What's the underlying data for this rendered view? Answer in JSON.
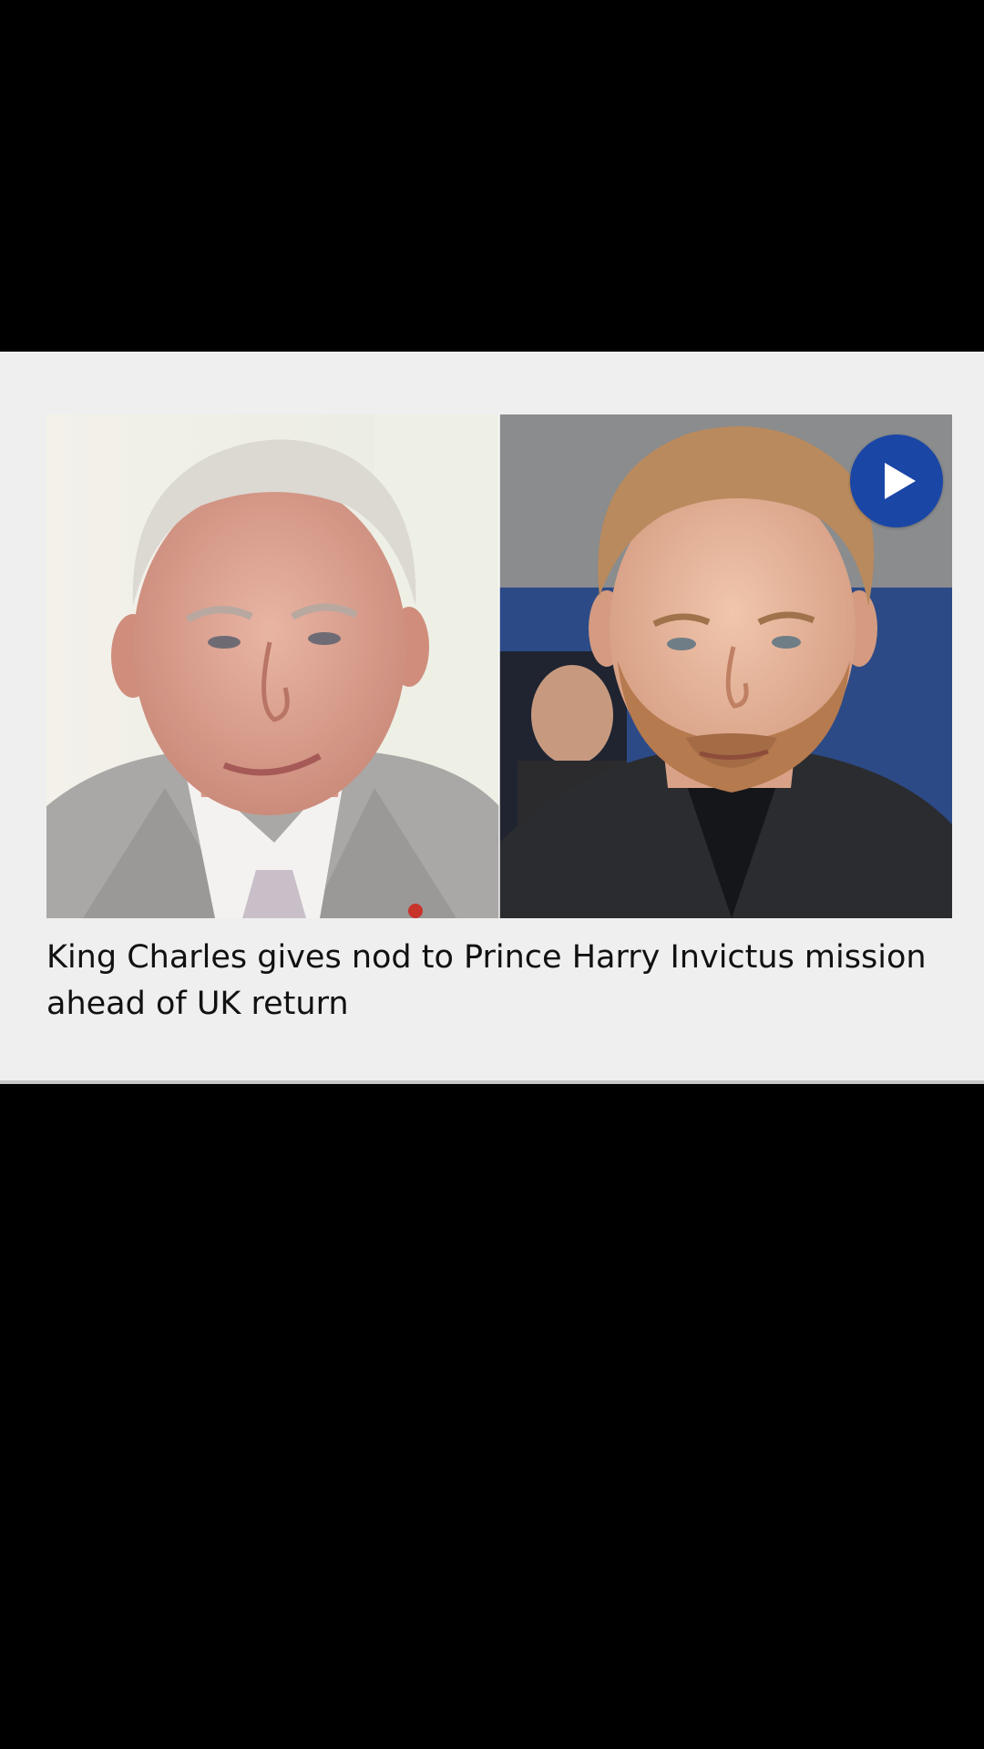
{
  "article": {
    "headline": "King Charles gives nod to Prince Harry Invictus mission ahead of UK return",
    "images": [
      {
        "subject": "King Charles",
        "icon": "portrait-photo"
      },
      {
        "subject": "Prince Harry",
        "icon": "portrait-photo"
      }
    ],
    "play_icon": "play-icon",
    "accent_color": "#1a46a6"
  },
  "colors": {
    "background": "#000000",
    "card": "#efefef",
    "text": "#111111"
  }
}
